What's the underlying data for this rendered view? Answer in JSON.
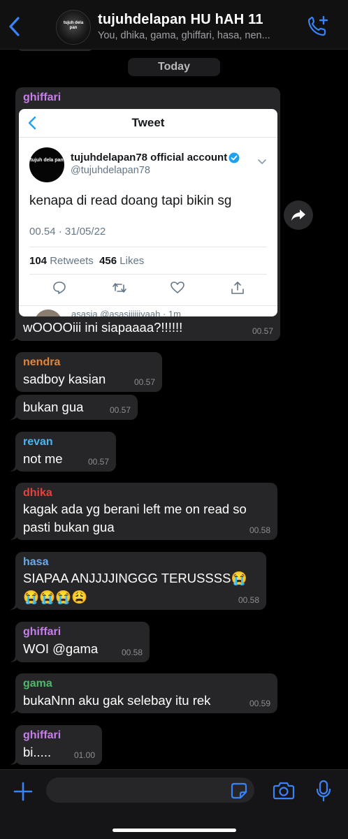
{
  "header": {
    "back_icon": "chevron-left-icon",
    "group_name": "tujuhdelapan HU hAH 11",
    "members": "You, dhika, gama, ghiffari, hasa, nen...",
    "avatar_text": "tujuh dela pan",
    "call_icon": "phone-plus-icon"
  },
  "colors": {
    "accent": "#3b82f6",
    "bubble": "#262628",
    "ghiffari": "#c77dec",
    "nendra": "#e0853b",
    "revan": "#4fb3ee",
    "dhika": "#e8413c",
    "hasa": "#6aa9ec",
    "gama": "#4fb86a"
  },
  "date_label": "Today",
  "tweet": {
    "header": "Tweet",
    "avatar_text": "tujuh dela pan",
    "name": "tujuhdelapan78 official account",
    "handle": "@tujuhdelapan78",
    "text": "kenapa di read doang tapi bikin sg",
    "date": "00.54 · 31/05/22",
    "retweets": "104",
    "retweets_label": "Retweets",
    "likes": "456",
    "likes_label": "Likes",
    "reply_preview": "asasia @asasiiiiiiyaah · 1m"
  },
  "messages": [
    {
      "sender": "ghiffari",
      "text": "wOOOOiii ini siapaaaa?!!!!!!",
      "time": "00.57"
    },
    {
      "sender": "nendra",
      "text": "sadboy kasian",
      "time": "00.57"
    },
    {
      "sender": "",
      "text": "bukan gua",
      "time": "00.57"
    },
    {
      "sender": "revan",
      "text": "not me",
      "time": "00.57"
    },
    {
      "sender": "dhika",
      "line1": "kagak ada yg berani left me on read so",
      "line2": "pasti bukan gua",
      "time": "00.58"
    },
    {
      "sender": "hasa",
      "line1": "SIAPAA ANJJJJINGGG TERUSSSS😭",
      "line2": "😭😭😭😩",
      "time": "00.58"
    },
    {
      "sender": "ghiffari",
      "text": "WOI @gama",
      "time": "00.58"
    },
    {
      "sender": "gama",
      "text": "bukaNnn aku gak selebay itu rek",
      "time": "00.59"
    },
    {
      "sender": "ghiffari",
      "text": "bi.....",
      "time": "01.00"
    }
  ]
}
